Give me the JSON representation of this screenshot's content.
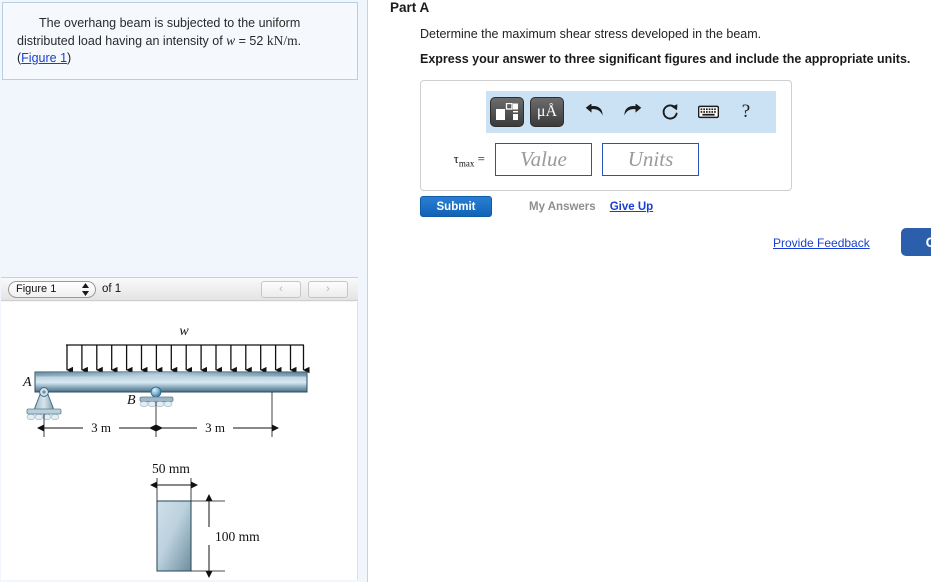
{
  "question": {
    "text_line1": "The overhang beam is subjected to the uniform",
    "text_line2_pre": "distributed load having an intensity of ",
    "var_w": "w",
    "eq": " = 52",
    "units": "kN/m",
    "period": ".",
    "figure_link": "Figure 1",
    "link_open": "(",
    "link_close": ")"
  },
  "figure_bar": {
    "selected": "Figure 1",
    "of_label": "of 1",
    "prev_icon": "‹",
    "next_icon": "›",
    "spin_up": "▲",
    "spin_down": "▼"
  },
  "figure": {
    "load_label": "w",
    "support_a": "A",
    "support_b": "B",
    "dim_left": "3 m",
    "dim_right": "3 m",
    "width_label": "50 mm",
    "height_label": "100 mm",
    "arrow_count": 17,
    "beam_gradient_light": "#dbe9f2",
    "beam_gradient_dark": "#4a6e86"
  },
  "part": {
    "title": "Part A",
    "prompt": "Determine the maximum shear stress developed in the beam.",
    "express": "Express your answer to three significant figures and include the appropriate units."
  },
  "toolbar": {
    "template_icon": "math-template-icon",
    "units_icon_label": "μÅ",
    "undo_icon": "undo-icon",
    "redo_icon": "redo-icon",
    "reset_icon": "reset-icon",
    "keyboard_icon": "keyboard-icon",
    "help_label": "?"
  },
  "answer": {
    "symbol": "τ",
    "subscript": "max",
    "equals": "=",
    "value_placeholder": "Value",
    "units_placeholder": "Units"
  },
  "actions": {
    "submit": "Submit",
    "my_answers": "My Answers",
    "give_up": "Give Up",
    "provide_feedback": "Provide Feedback",
    "continue": "Co"
  },
  "colors": {
    "accent_blue": "#1063b5",
    "link_blue": "#1a3fd0",
    "toolbar_bg": "#cbe2f5",
    "panel_bg": "#f1f6fc",
    "continue_blue": "#2b5eab"
  }
}
